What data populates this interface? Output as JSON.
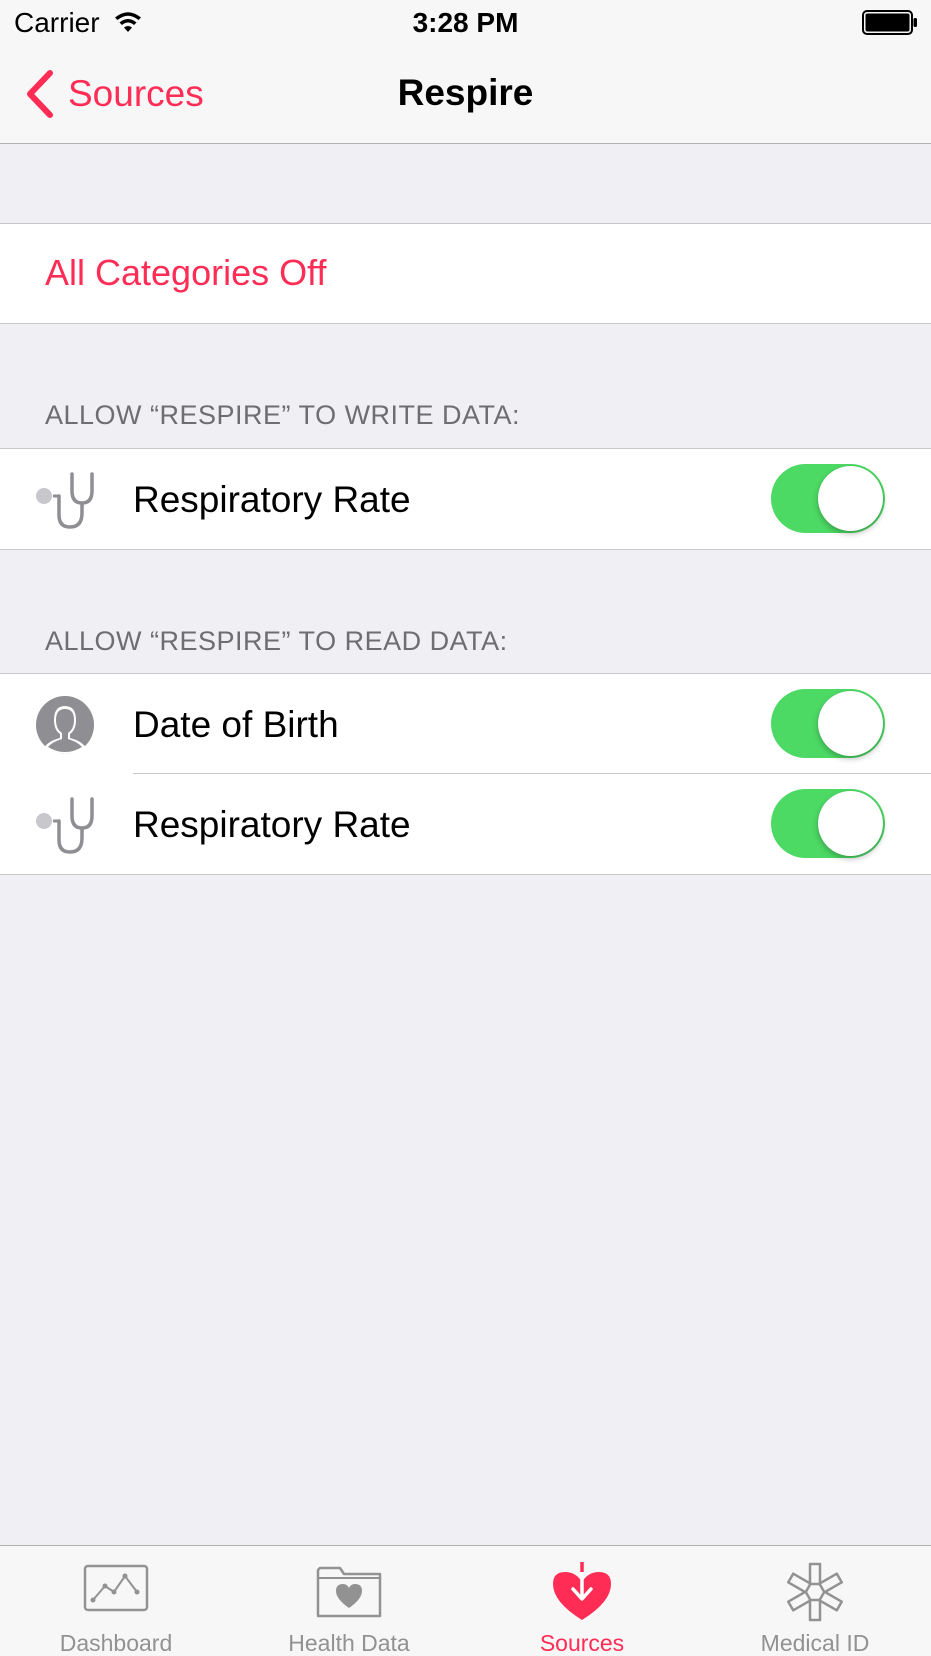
{
  "status_bar": {
    "carrier": "Carrier",
    "time": "3:28 PM",
    "wifi_icon": "wifi-icon",
    "battery_icon": "battery-icon"
  },
  "nav_bar": {
    "back_label": "Sources",
    "title": "Respire"
  },
  "all_categories": {
    "label": "All Categories Off"
  },
  "write_section": {
    "header": "ALLOW “RESPIRE” TO WRITE DATA:",
    "items": [
      {
        "label": "Respiratory Rate",
        "icon": "stethoscope-icon",
        "enabled": true
      }
    ]
  },
  "read_section": {
    "header": "ALLOW “RESPIRE” TO READ DATA:",
    "items": [
      {
        "label": "Date of Birth",
        "icon": "person-icon",
        "enabled": true
      },
      {
        "label": "Respiratory Rate",
        "icon": "stethoscope-icon",
        "enabled": true
      }
    ]
  },
  "tab_bar": {
    "tabs": [
      {
        "label": "Dashboard",
        "icon": "dashboard-icon",
        "active": false
      },
      {
        "label": "Health Data",
        "icon": "health-data-icon",
        "active": false
      },
      {
        "label": "Sources",
        "icon": "sources-icon",
        "active": true
      },
      {
        "label": "Medical ID",
        "icon": "medical-id-icon",
        "active": false
      }
    ]
  },
  "colors": {
    "accent": "#ff2d55",
    "toggle_on": "#4cd964",
    "background": "#efeff4",
    "icon_gray": "#8e8e93"
  }
}
